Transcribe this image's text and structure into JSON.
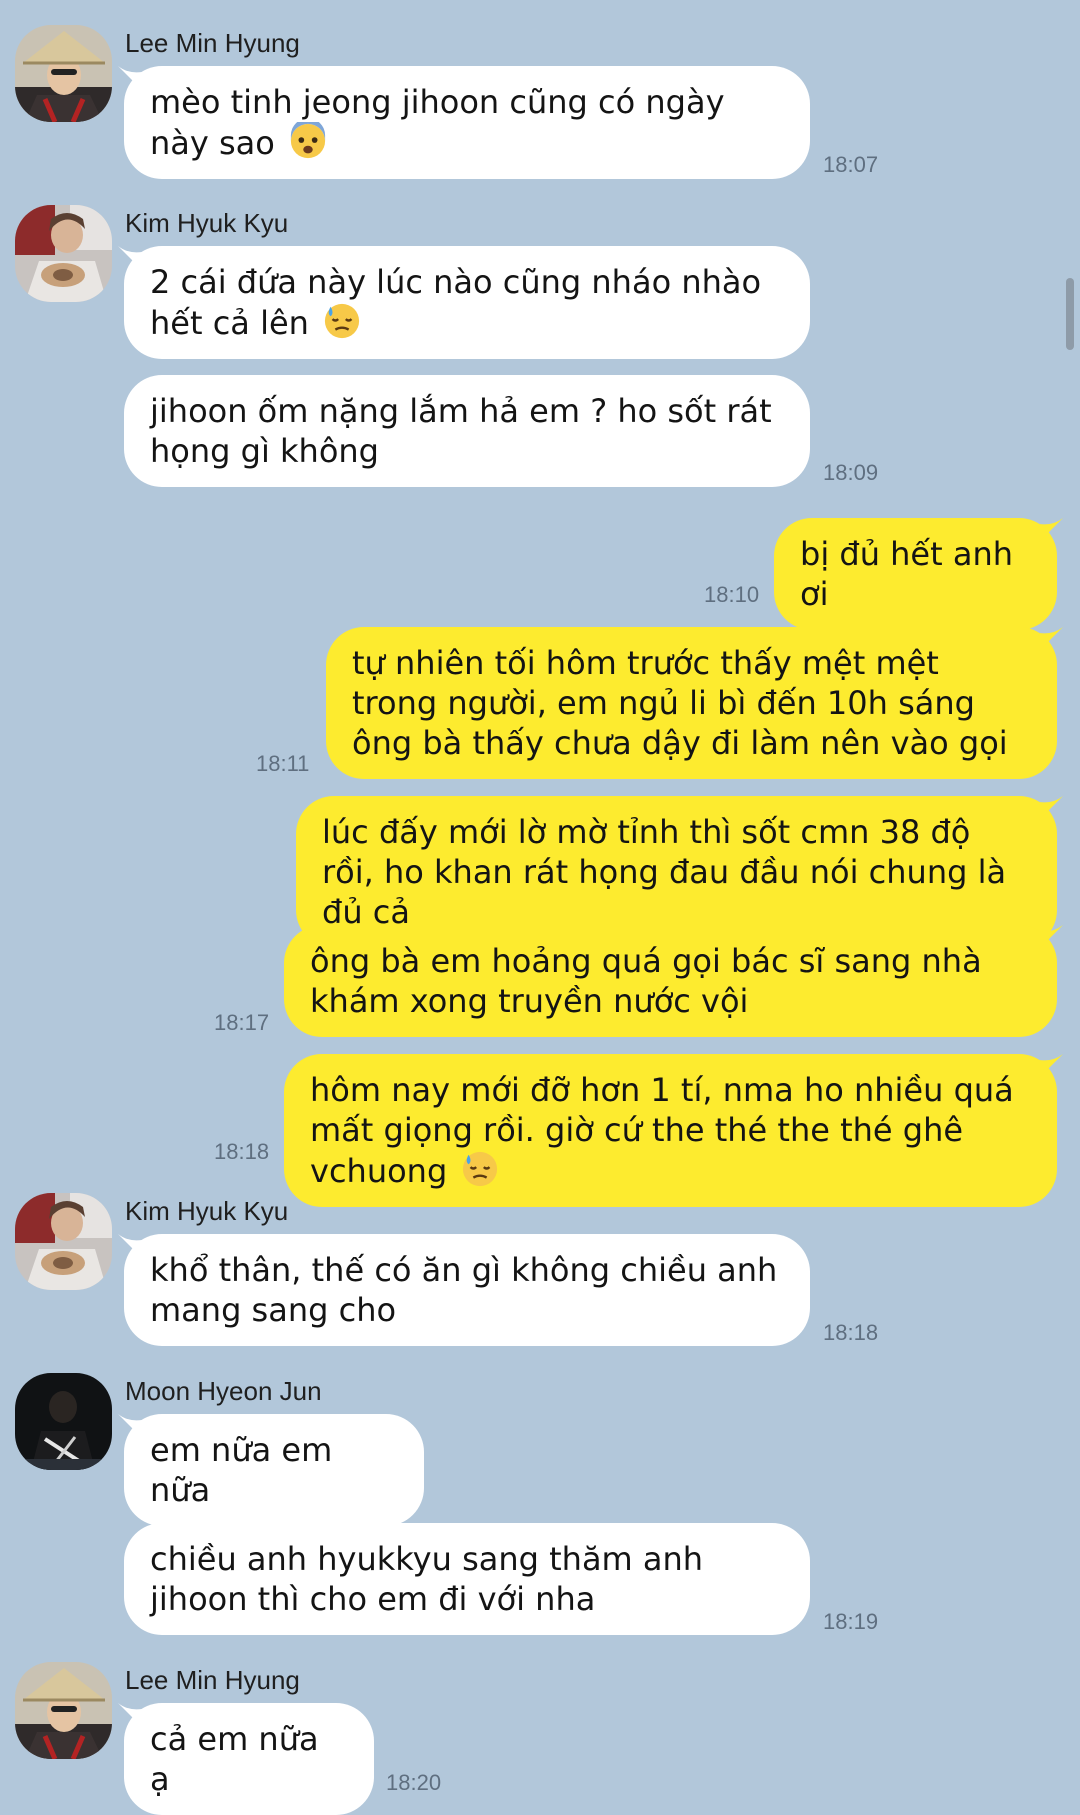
{
  "messages": [
    {
      "sender": "Lee Min Hyung",
      "text": "mèo tinh jeong jihoon cũng có ngày này sao",
      "emoji": "fearful-face-icon",
      "time": "18:07"
    },
    {
      "sender": "Kim Hyuk Kyu",
      "text": "2 cái đứa này lúc nào cũng nháo nhào hết cả lên",
      "emoji": "sweat-face-icon"
    },
    {
      "text": "jihoon ốm nặng lắm hả em ? ho sốt rát họng gì không",
      "time": "18:09"
    },
    {
      "text": "bị đủ hết anh ơi",
      "time": "18:10"
    },
    {
      "text": "tự nhiên tối hôm trước thấy mệt mệt trong người, em ngủ li bì đến 10h sáng ông bà thấy chưa dậy đi làm nên vào gọi",
      "time": "18:11"
    },
    {
      "text": "lúc đấy mới lờ mờ tỉnh thì sốt cmn 38 độ rồi, ho khan rát họng đau đầu nói chung là đủ cả"
    },
    {
      "text": "ông bà em hoảng quá gọi bác sĩ sang nhà khám xong truyền nước vội",
      "time": "18:17"
    },
    {
      "text": "hôm nay mới đỡ hơn 1 tí, nma ho nhiều quá mất giọng rồi. giờ cứ the thé the thé ghê vchuong",
      "emoji": "sweat-face-icon",
      "time": "18:18"
    },
    {
      "sender": "Kim Hyuk Kyu",
      "text": "khổ thân, thế có ăn gì không chiều anh mang sang cho",
      "time": "18:18"
    },
    {
      "sender": "Moon Hyeon Jun",
      "text": "em nữa em nữa"
    },
    {
      "text": "chiều anh hyukkyu sang thăm anh jihoon thì cho em đi với nha",
      "time": "18:19"
    },
    {
      "sender": "Lee Min Hyung",
      "text": "cả em nữa ạ",
      "time": "18:20"
    }
  ],
  "colors": {
    "background": "#b2c7da",
    "incoming_bubble": "#ffffff",
    "outgoing_bubble": "#fdeb2f",
    "timestamp": "#5f6f80"
  }
}
